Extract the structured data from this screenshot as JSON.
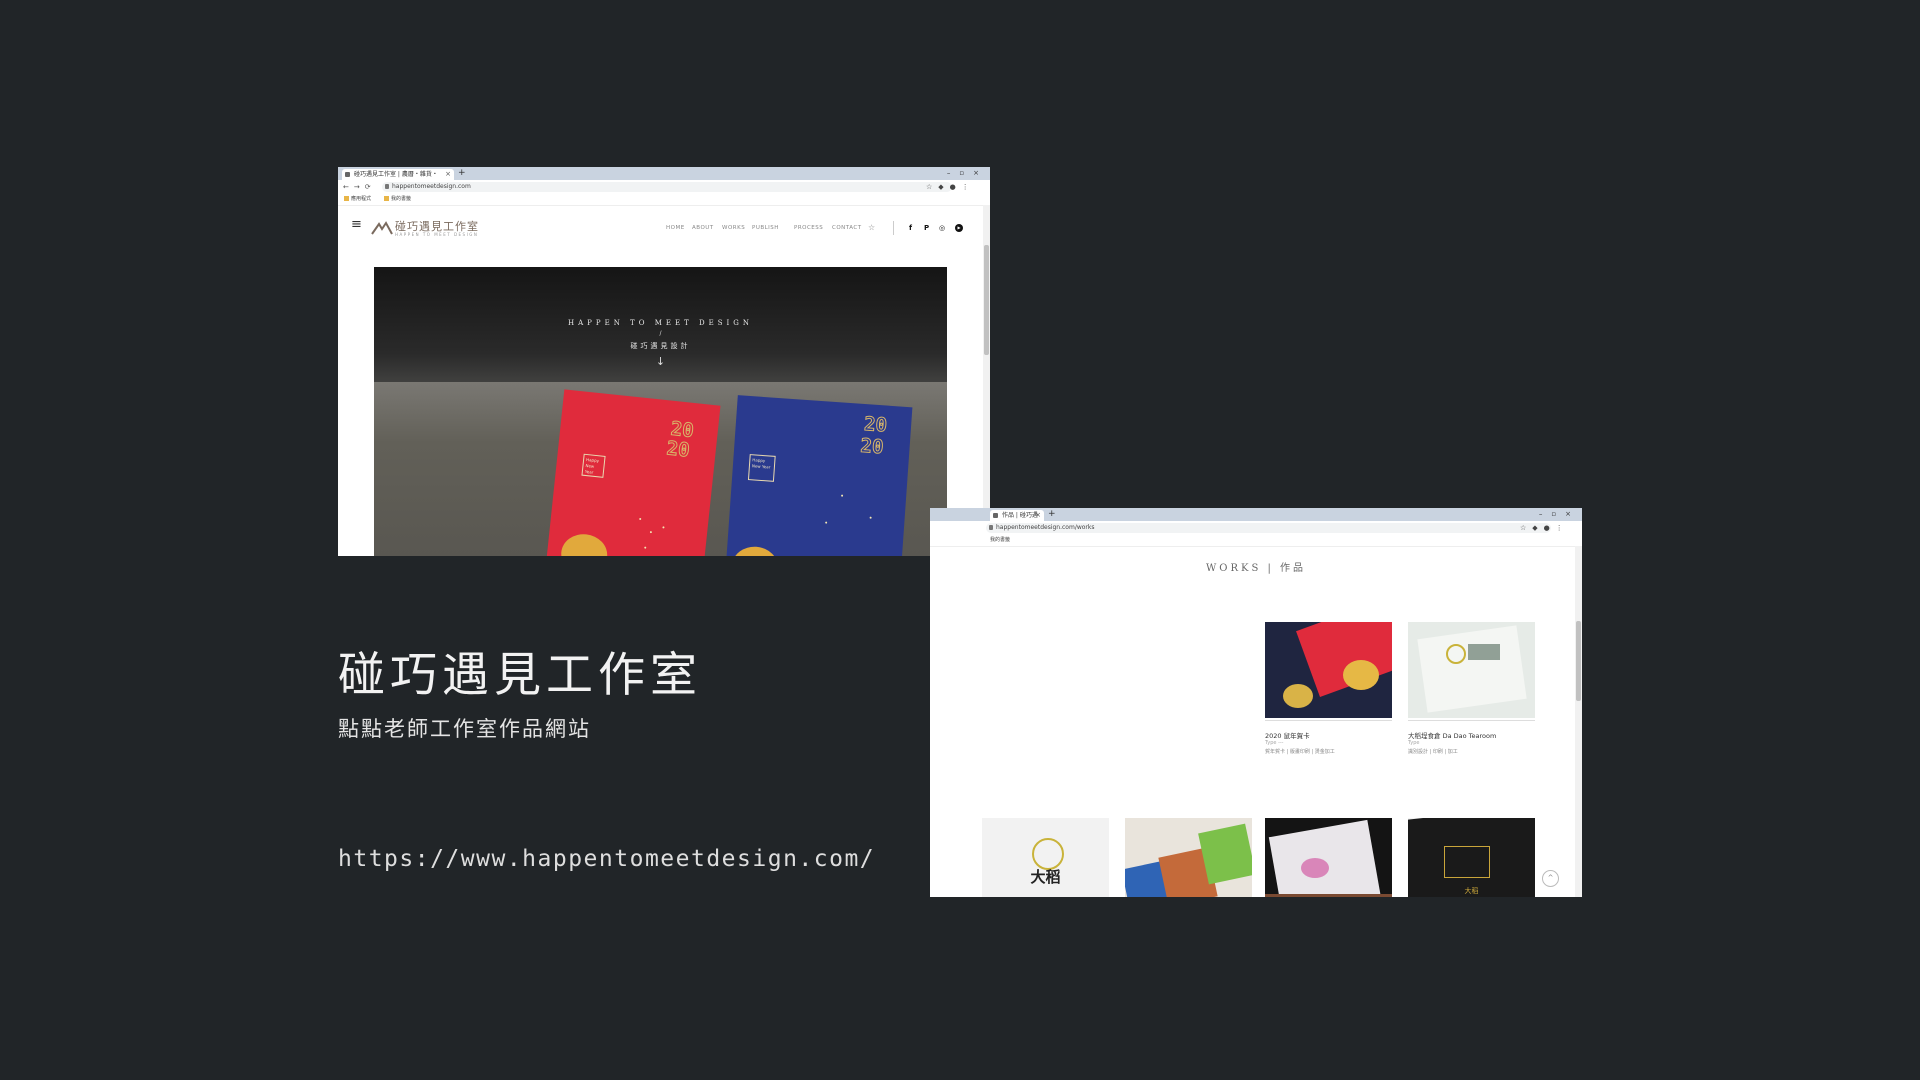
{
  "slide": {
    "title": "碰巧遇見工作室",
    "subtitle": "點點老師工作室作品網站",
    "url": "https://www.happentomeetdesign.com/"
  },
  "home_screenshot": {
    "tab_title": "碰巧遇見工作室 | 農曆・雜貨・",
    "new_tab": "+",
    "window_controls": "–▫×",
    "nav_icons": "←→⟳",
    "address": "happentomeetdesign.com",
    "addr_icons": "☆◆●⋮",
    "bookmarks": [
      "應用程式",
      "我的書籤"
    ],
    "logo_text": "碰巧遇見工作室",
    "logo_sub": "HAPPEN TO MEET DESIGN",
    "nav": [
      "HOME",
      "ABOUT",
      "WORKS",
      "PUBLISH",
      "PROCESS",
      "CONTACT"
    ],
    "social": [
      "f",
      "P",
      "◎",
      "▶"
    ],
    "hero": {
      "title": "HAPPEN TO MEET DESIGN",
      "slash": "/",
      "cn": "碰巧遇見設計",
      "arrow": "↓",
      "card_year_top": "20",
      "card_year_bottom": "20",
      "card_greeting": "Happy New Year"
    },
    "top_button": "^"
  },
  "works_screenshot": {
    "tab_title": "作品 | 碰巧遇",
    "new_tab": "+",
    "window_controls": "–▫×",
    "address": "happentomeetdesign.com/works",
    "addr_icons": "☆◆●⋮",
    "bookmarks": "我的書籤",
    "heading": "WORKS | 作品",
    "items": [
      {
        "title": "2020 鼠年賀卡",
        "type": "Type ---",
        "tags": "賀年賀卡 | 版畫印刷 | 燙金加工"
      },
      {
        "title": "大稻埕食倉 Da Dao Tearoom",
        "type": "Type",
        "tags": "識別設計 | 印刷 | 加工"
      }
    ],
    "bottom_thumbs": [
      "大稻",
      "",
      "",
      "大稻"
    ],
    "top_button": "^"
  },
  "colors": {
    "background": "#212528",
    "red_card": "#e02b3c",
    "blue_card": "#2a3a8e",
    "gold": "#d8b66a"
  }
}
